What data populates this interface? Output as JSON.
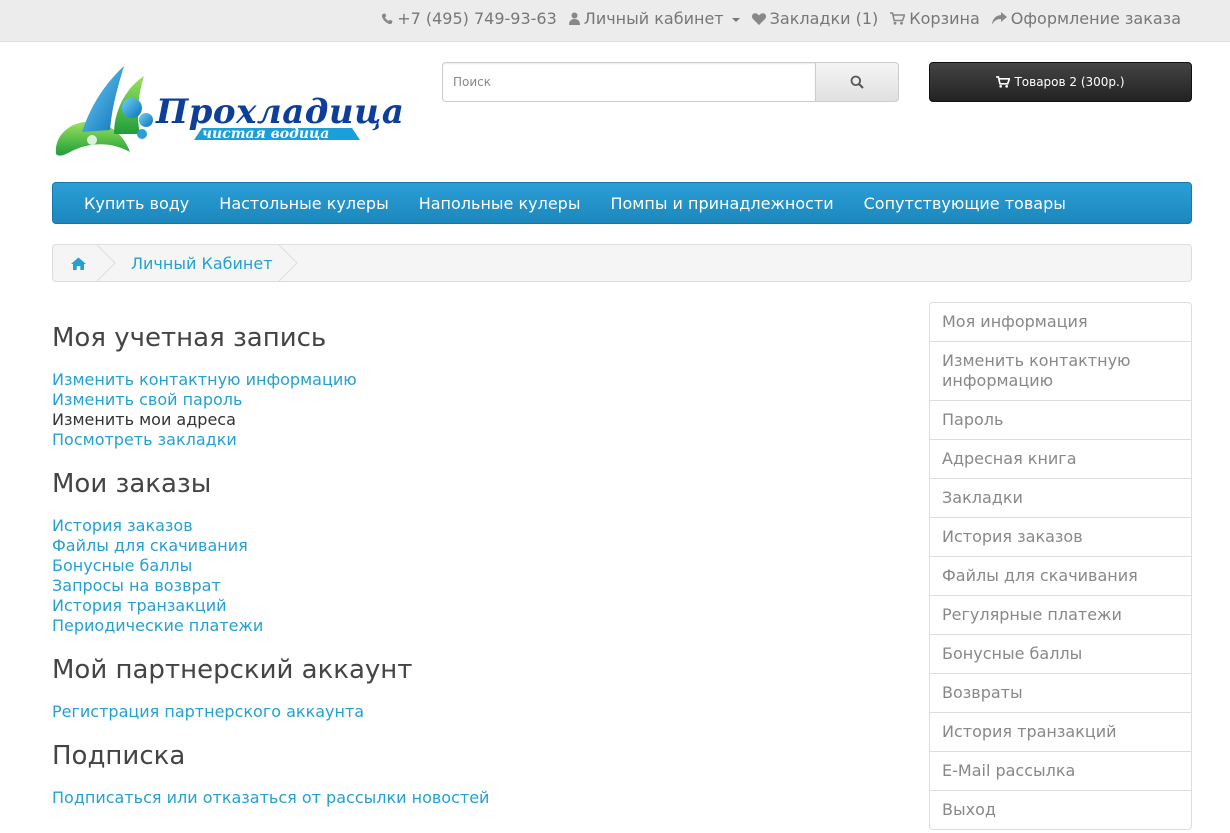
{
  "topbar": {
    "phone": "+7 (495) 749-93-63",
    "account": "Личный кабинет",
    "wishlist": "Закладки (1)",
    "cart": "Корзина",
    "checkout": "Оформление заказа"
  },
  "logo": {
    "title": "Прохладица",
    "subtitle": "чистая водица"
  },
  "search": {
    "placeholder": "Поиск"
  },
  "cart_button": {
    "label": "Товаров 2 (300р.)"
  },
  "menu": {
    "items": [
      "Купить воду",
      "Настольные кулеры",
      "Напольные кулеры",
      "Помпы и принадлежности",
      "Сопутствующие товары"
    ]
  },
  "breadcrumb": {
    "current": "Личный Кабинет"
  },
  "content": {
    "sections": [
      {
        "title": "Моя учетная запись",
        "links": [
          "Изменить контактную информацию",
          "Изменить свой пароль",
          "Изменить мои адреса",
          "Посмотреть закладки"
        ]
      },
      {
        "title": "Мои заказы",
        "links": [
          "История заказов",
          "Файлы для скачивания",
          "Бонусные баллы",
          "Запросы на возврат",
          "История транзакций",
          "Периодические платежи"
        ]
      },
      {
        "title": "Мой партнерский аккаунт",
        "links": [
          "Регистрация партнерского аккаунта"
        ]
      },
      {
        "title": "Подписка",
        "links": [
          "Подписаться или отказаться от рассылки новостей"
        ]
      }
    ]
  },
  "sidebar": {
    "items": [
      "Моя информация",
      "Изменить контактную информацию",
      "Пароль",
      "Адресная книга",
      "Закладки",
      "История заказов",
      "Файлы для скачивания",
      "Регулярные платежи",
      "Бонусные баллы",
      "Возвраты",
      "История транзакций",
      "E-Mail рассылка",
      "Выход"
    ]
  },
  "colors": {
    "accent": "#23a1d1",
    "menu": "#2295cd",
    "cart_button": "#2d2d2d"
  }
}
